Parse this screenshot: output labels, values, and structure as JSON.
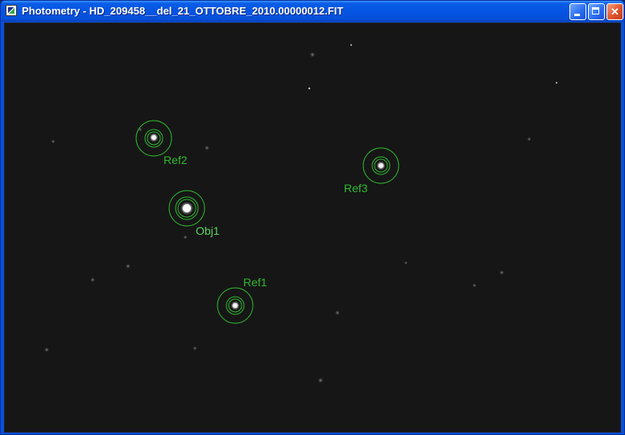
{
  "window": {
    "title": "Photometry - HD_209458__del_21_OTTOBRE_2010.00000012.FIT",
    "app_icon": "photometry-app-icon",
    "controls": [
      "minimize-icon",
      "maximize-icon",
      "close-icon"
    ]
  },
  "image": {
    "background_color": "#161616",
    "aperture_color": "#2fb82f"
  },
  "apertures": [
    {
      "name": "Ref2",
      "kind": "reference"
    },
    {
      "name": "Obj1",
      "kind": "object"
    },
    {
      "name": "Ref3",
      "kind": "reference"
    },
    {
      "name": "Ref1",
      "kind": "reference"
    }
  ]
}
